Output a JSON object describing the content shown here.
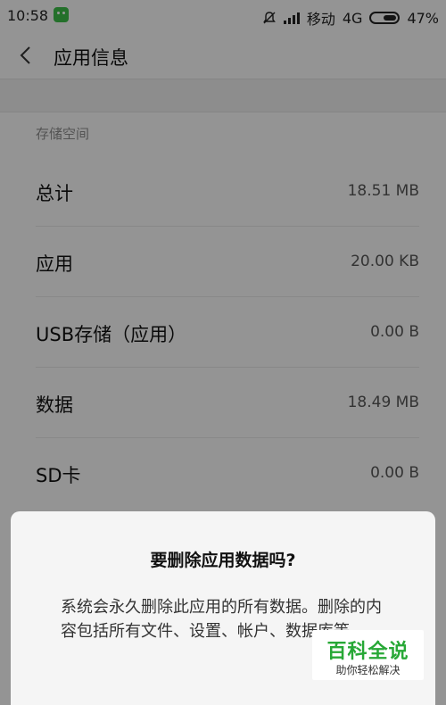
{
  "status_bar": {
    "time": "10:58",
    "carrier": "移动",
    "network": "4G",
    "battery": "47%",
    "icons": [
      "app-icon",
      "bell-off-icon",
      "signal-icon",
      "battery-icon"
    ]
  },
  "header": {
    "title": "应用信息",
    "back_icon": "chevron-left-icon"
  },
  "storage": {
    "section_label": "存储空间",
    "rows": [
      {
        "label": "总计",
        "value": "18.51 MB"
      },
      {
        "label": "应用",
        "value": "20.00 KB"
      },
      {
        "label": "USB存储（应用）",
        "value": "0.00 B"
      },
      {
        "label": "数据",
        "value": "18.49 MB"
      },
      {
        "label": "SD卡",
        "value": "0.00 B"
      }
    ]
  },
  "dialog": {
    "title": "要删除应用数据吗?",
    "message": "系统会永久删除此应用的所有数据。删除的内容包括所有文件、设置、帐户、数据库等。"
  },
  "watermark": {
    "main": "百科全说",
    "sub": "助你轻松解决"
  },
  "colors": {
    "watermark_green": "#27a836",
    "overlay": "#000000"
  }
}
